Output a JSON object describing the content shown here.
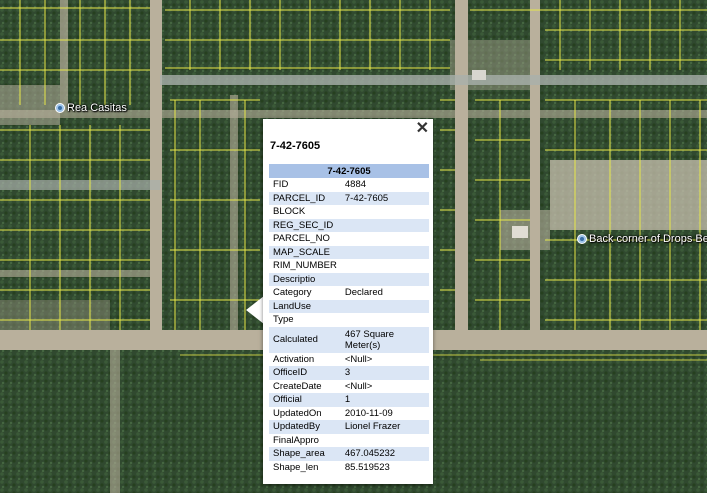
{
  "map": {
    "labels": [
      {
        "text": "Rea Casitas",
        "icon": "location-pin-icon"
      },
      {
        "text": "Back corner of Drops Bel",
        "icon": "location-pin-icon"
      }
    ]
  },
  "popup": {
    "title": "7-42-7605",
    "header": "7-42-7605",
    "close_label": "✕",
    "fields": [
      {
        "key": "FID",
        "value": "4884"
      },
      {
        "key": "PARCEL_ID",
        "value": "7-42-7605"
      },
      {
        "key": "BLOCK",
        "value": ""
      },
      {
        "key": "REG_SEC_ID",
        "value": ""
      },
      {
        "key": "PARCEL_NO",
        "value": ""
      },
      {
        "key": "MAP_SCALE",
        "value": ""
      },
      {
        "key": "RIM_NUMBER",
        "value": ""
      },
      {
        "key": "Descriptio",
        "value": ""
      },
      {
        "key": "Category",
        "value": "Declared"
      },
      {
        "key": "LandUse",
        "value": ""
      },
      {
        "key": "Type",
        "value": ""
      },
      {
        "key": "Calculated",
        "value": "467 Square Meter(s)"
      },
      {
        "key": "Activation",
        "value": "<Null>"
      },
      {
        "key": "OfficeID",
        "value": "3"
      },
      {
        "key": "CreateDate",
        "value": "<Null>"
      },
      {
        "key": "Official",
        "value": "1"
      },
      {
        "key": "UpdatedOn",
        "value": "2010-11-09"
      },
      {
        "key": "UpdatedBy",
        "value": "Lionel Frazer"
      },
      {
        "key": "FinalAppro",
        "value": ""
      },
      {
        "key": "Shape_area",
        "value": "467.045232"
      },
      {
        "key": "Shape_len",
        "value": "85.519523"
      }
    ]
  },
  "colors": {
    "vegetation": "#2f4a32",
    "road": "#b7ad9a",
    "parcel_line": "#e8e84a",
    "table_header": "#a8c1e6",
    "table_alt_row": "#dbe6f5"
  }
}
